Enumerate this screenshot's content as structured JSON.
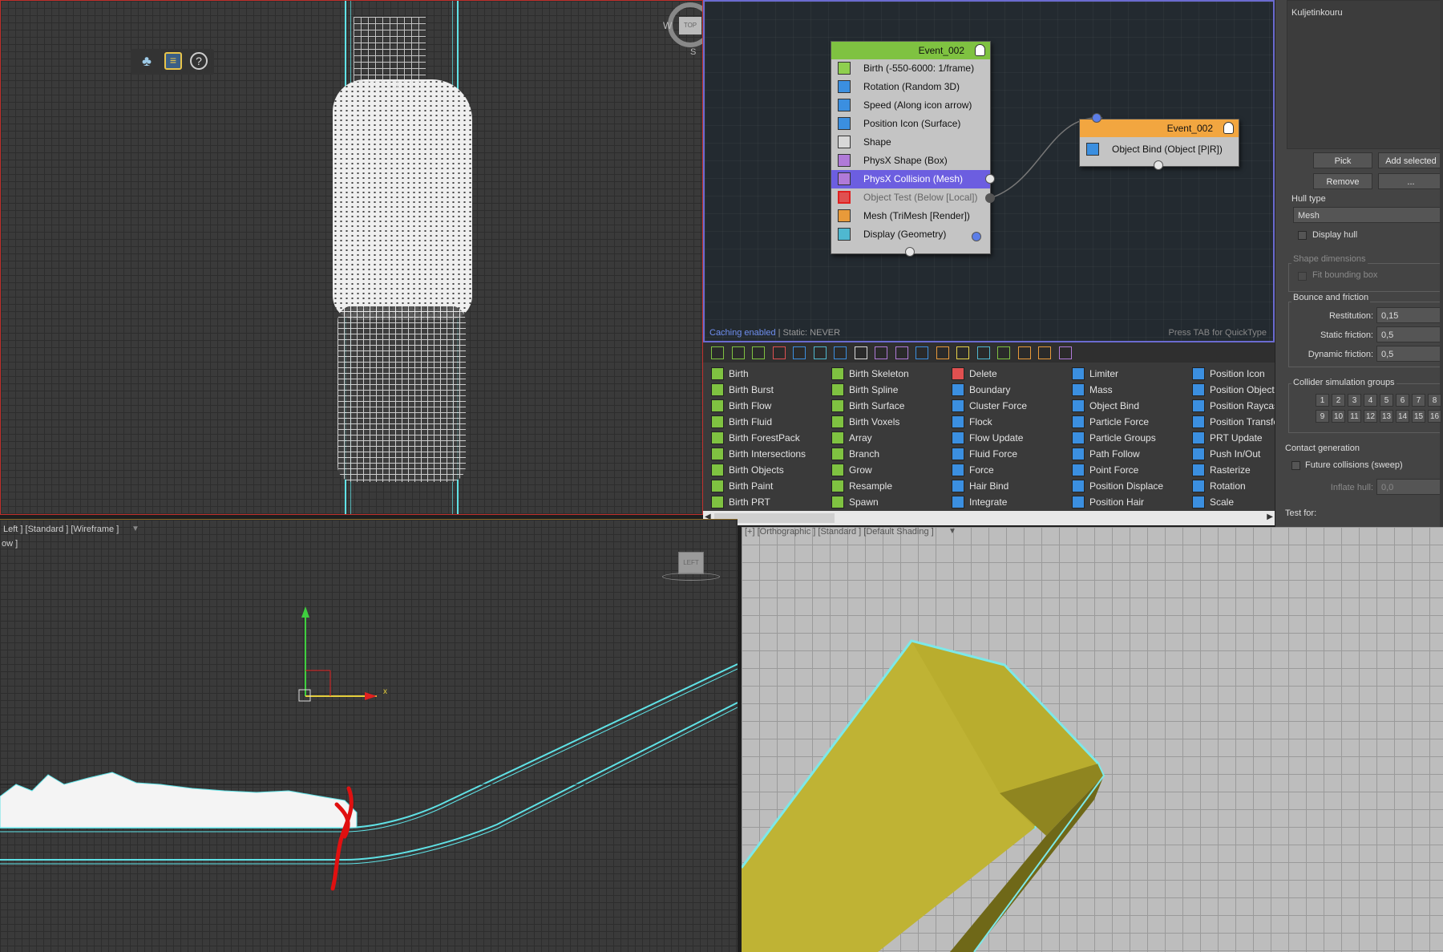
{
  "viewports": {
    "left_label": "Left ] [Standard ] [Wireframe ]",
    "left_label2": "ow ]",
    "left_cube": "LEFT",
    "persp_label": "[+] [Orthographic ] [Standard ] [Default Shading ]",
    "top_compass": {
      "w": "W",
      "s": "S",
      "face": "TOP"
    },
    "axis_x": "x"
  },
  "particle_view": {
    "event1": {
      "title": "Event_002",
      "head_color": "#7fc241",
      "operators": [
        {
          "label": "Birth (-550-6000: 1/frame)",
          "icon": "birth-icon",
          "color": "#8fcf4f",
          "state": "normal"
        },
        {
          "label": "Rotation (Random 3D)",
          "icon": "rotation-icon",
          "color": "#3b8fe0",
          "state": "normal"
        },
        {
          "label": "Speed (Along icon arrow)",
          "icon": "speed-icon",
          "color": "#3b8fe0",
          "state": "normal"
        },
        {
          "label": "Position Icon (Surface)",
          "icon": "position-icon",
          "color": "#3b8fe0",
          "state": "normal"
        },
        {
          "label": "Shape",
          "icon": "shape-icon",
          "color": "#d8d8d8",
          "state": "normal"
        },
        {
          "label": "PhysX Shape (Box)",
          "icon": "physx-shape-icon",
          "color": "#b07ad8",
          "state": "normal"
        },
        {
          "label": "PhysX Collision (Mesh)",
          "icon": "physx-collision-icon",
          "color": "#b07ad8",
          "state": "selected"
        },
        {
          "label": "Object Test (Below [Local])",
          "icon": "object-test-icon",
          "color": "#e05050",
          "state": "disabled"
        },
        {
          "label": "Mesh (TriMesh [Render])",
          "icon": "mesh-icon",
          "color": "#e89a3a",
          "state": "normal"
        },
        {
          "label": "Display (Geometry)",
          "icon": "display-icon",
          "color": "#4fb8d0",
          "state": "normal"
        }
      ]
    },
    "event2": {
      "title": "Event_002",
      "head_color": "#f2a640",
      "operators": [
        {
          "label": "Object Bind (Object [P|R])",
          "icon": "object-bind-icon",
          "color": "#3b8fe0",
          "state": "normal"
        }
      ]
    },
    "status_caching": "Caching enabled",
    "status_static": " | Static: NEVER",
    "hint": "Press TAB for QuickType"
  },
  "depot": {
    "toolbar_colors": [
      "#7fc241",
      "#7fc241",
      "#7fc241",
      "#e05050",
      "#3b8fe0",
      "#4fb8d0",
      "#3b8fe0",
      "#d8d8d8",
      "#b07ad8",
      "#b07ad8",
      "#3b8fe0",
      "#e89a3a",
      "#e8d24a",
      "#4fb8d0",
      "#7fc241",
      "#e89a3a",
      "#e89a3a",
      "#b07ad8"
    ],
    "columns": [
      {
        "color": "#7fc241",
        "items": [
          "Birth",
          "Birth Burst",
          "Birth Flow",
          "Birth Fluid",
          "Birth ForestPack",
          "Birth Intersections",
          "Birth Objects",
          "Birth Paint",
          "Birth PRT"
        ]
      },
      {
        "color": "#7fc241",
        "items": [
          "Birth Skeleton",
          "Birth Spline",
          "Birth Surface",
          "Birth Voxels",
          "Array",
          "Branch",
          "Grow",
          "Resample",
          "Spawn"
        ]
      },
      {
        "color": "#3b8fe0",
        "items": [
          "Delete",
          "Boundary",
          "Cluster Force",
          "Flock",
          "Flow Update",
          "Fluid Force",
          "Force",
          "Hair Bind",
          "Integrate"
        ]
      },
      {
        "color": "#3b8fe0",
        "items": [
          "Limiter",
          "Mass",
          "Object Bind",
          "Particle Force",
          "Particle Groups",
          "Path Follow",
          "Point Force",
          "Position Displace",
          "Position Hair"
        ]
      },
      {
        "color": "#3b8fe0",
        "items": [
          "Position Icon",
          "Position Object",
          "Position Raycast",
          "Position Transfer",
          "PRT Update",
          "Push In/Out",
          "Rasterize",
          "Rotation",
          "Scale"
        ]
      }
    ]
  },
  "params": {
    "list_items": [
      "Kuljetinkouru"
    ],
    "pick": "Pick",
    "add_selected": "Add selected",
    "remove": "Remove",
    "more": "...",
    "hull_type_label": "Hull type",
    "hull_type_value": "Mesh",
    "display_hull": "Display hull",
    "shape_dimensions": "Shape dimensions",
    "fit_bounding_box": "Fit bounding box",
    "bounce_friction": "Bounce and friction",
    "restitution_label": "Restitution:",
    "restitution_value": "0,15",
    "static_friction_label": "Static friction:",
    "static_friction_value": "0,5",
    "dynamic_friction_label": "Dynamic friction:",
    "dynamic_friction_value": "0,5",
    "collider_groups": "Collider simulation groups",
    "group_numbers": [
      "1",
      "2",
      "3",
      "4",
      "5",
      "6",
      "7",
      "8",
      "9",
      "10",
      "11",
      "12",
      "13",
      "14",
      "15",
      "16"
    ],
    "contact_generation": "Contact generation",
    "future_collisions": "Future collisions (sweep)",
    "inflate_hull_label": "Inflate hull:",
    "inflate_hull_value": "0,0",
    "test_for": "Test for:"
  }
}
